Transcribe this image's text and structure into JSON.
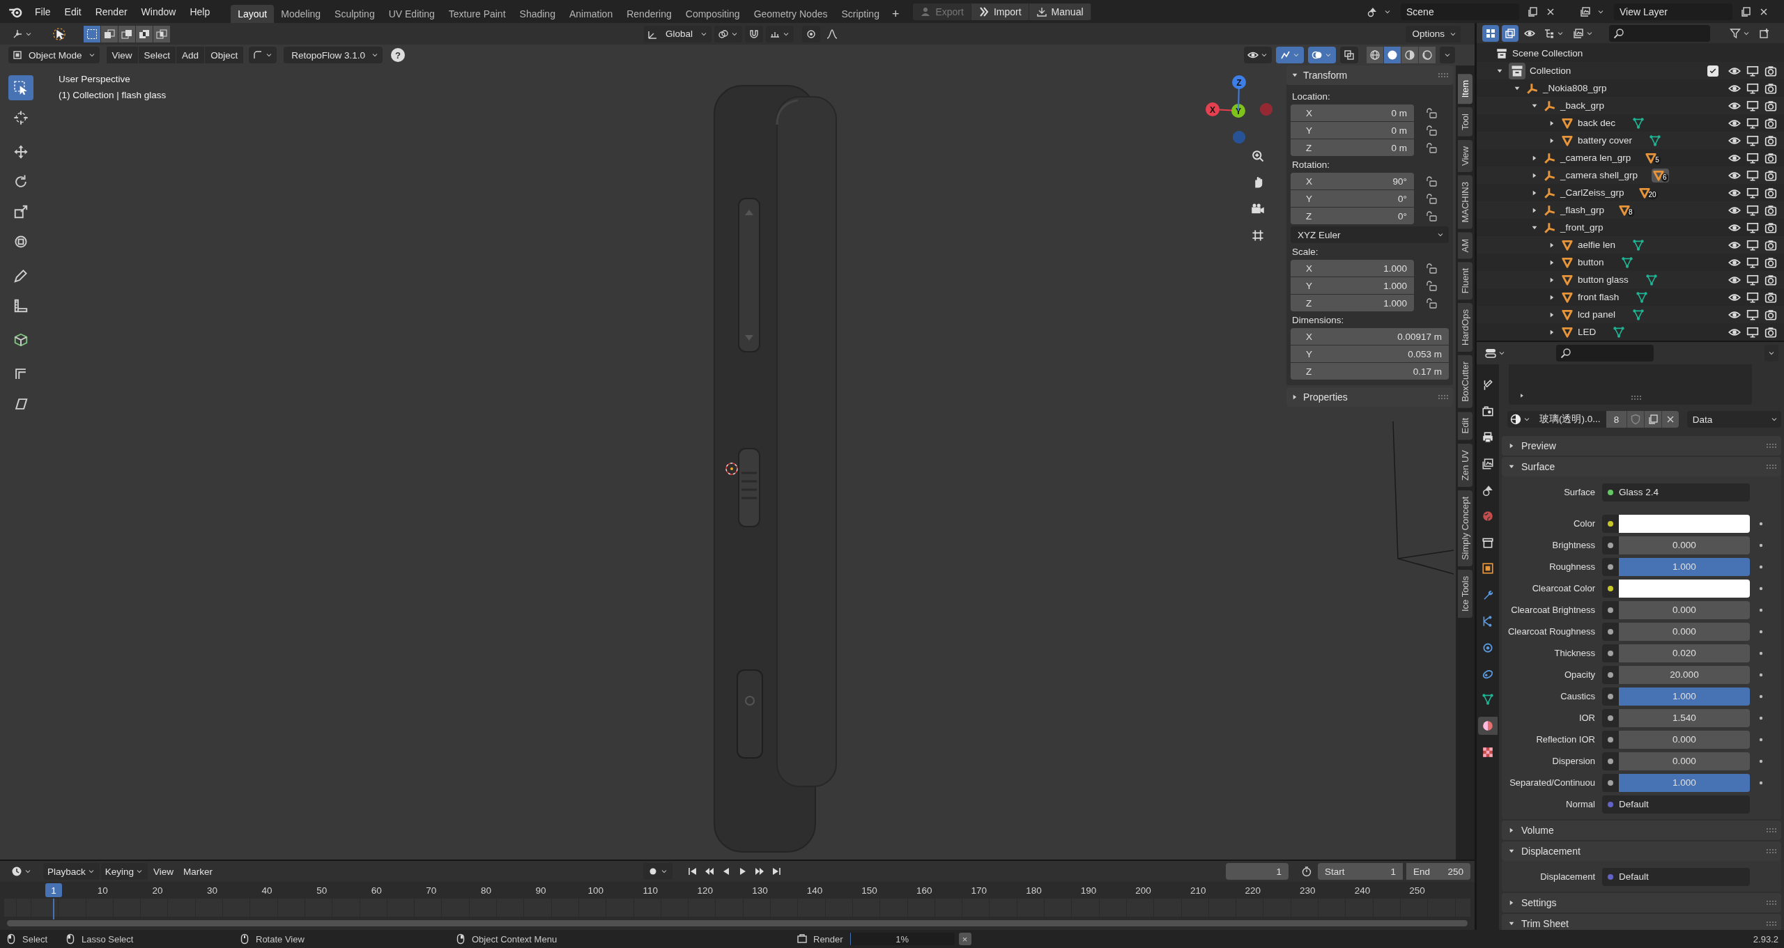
{
  "topbar": {
    "menus": [
      "File",
      "Edit",
      "Render",
      "Window",
      "Help"
    ],
    "workspaces": [
      {
        "label": "Layout",
        "selected": true
      },
      {
        "label": "Modeling",
        "selected": false
      },
      {
        "label": "Sculpting",
        "selected": false
      },
      {
        "label": "UV Editing",
        "selected": false
      },
      {
        "label": "Texture Paint",
        "selected": false
      },
      {
        "label": "Shading",
        "selected": false
      },
      {
        "label": "Animation",
        "selected": false
      },
      {
        "label": "Rendering",
        "selected": false
      },
      {
        "label": "Compositing",
        "selected": false
      },
      {
        "label": "Geometry Nodes",
        "selected": false
      },
      {
        "label": "Scripting",
        "selected": false
      }
    ],
    "add_workspace": "+",
    "addon_buttons": [
      {
        "label": "Export",
        "disabled": true
      },
      {
        "label": "Import",
        "disabled": false
      },
      {
        "label": "Manual",
        "disabled": false
      }
    ],
    "scene": "Scene",
    "view_layer": "View Layer"
  },
  "viewport": {
    "header": {
      "select_modes": [
        {
          "selected": true
        },
        {
          "selected": false
        },
        {
          "selected": false
        },
        {
          "selected": false
        },
        {
          "selected": false
        }
      ],
      "orientation": "Global",
      "options": "Options",
      "mode": "Object Mode",
      "menus": [
        "View",
        "Select",
        "Add",
        "Object"
      ],
      "addon_menu": "RetopoFlow 3.1.0",
      "help": "?",
      "toggles": [
        {
          "on": false
        },
        {
          "on": true
        },
        {
          "on": true
        },
        {
          "on": false
        }
      ],
      "shading": [
        {
          "selected": false
        },
        {
          "selected": true
        },
        {
          "selected": false
        },
        {
          "selected": false
        }
      ]
    },
    "tools": [
      {
        "selected": true
      },
      {
        "selected": false
      },
      {
        "selected": false
      },
      {
        "selected": false
      },
      {
        "selected": false
      },
      {
        "selected": false
      },
      {
        "selected": false
      },
      {
        "selected": false
      },
      {
        "selected": false
      },
      {
        "selected": false
      },
      {
        "selected": false
      }
    ],
    "overlay_text": [
      "User Perspective",
      "(1) Collection | flash glass"
    ],
    "gizmo": [
      {
        "label": "X",
        "color": "#e5404f"
      },
      {
        "label": "Y",
        "color": "#7fc21c"
      },
      {
        "label": "Z",
        "color": "#3d7fe6"
      }
    ]
  },
  "sidebar": {
    "tabs": [
      {
        "label": "Item",
        "selected": true
      },
      {
        "label": "Tool",
        "selected": false
      },
      {
        "label": "View",
        "selected": false
      },
      {
        "label": "MACHIN3",
        "selected": false
      },
      {
        "label": "AM",
        "selected": false
      },
      {
        "label": "Fluent",
        "selected": false
      },
      {
        "label": "HardOps",
        "selected": false
      },
      {
        "label": "BoxCutter",
        "selected": false
      },
      {
        "label": "Edit",
        "selected": false
      },
      {
        "label": "Zen UV",
        "selected": false
      },
      {
        "label": "Simply Concept",
        "selected": false
      },
      {
        "label": "Ice Tools",
        "selected": false
      }
    ],
    "panels": [
      {
        "title": "Transform",
        "expanded": true,
        "groups": [
          {
            "label": "Location:",
            "locks": true,
            "fields": [
              {
                "axis": "X",
                "value": "0 m"
              },
              {
                "axis": "Y",
                "value": "0 m"
              },
              {
                "axis": "Z",
                "value": "0 m"
              }
            ]
          },
          {
            "label": "Rotation:",
            "locks": true,
            "fields": [
              {
                "axis": "X",
                "value": "90°"
              },
              {
                "axis": "Y",
                "value": "0°"
              },
              {
                "axis": "Z",
                "value": "0°"
              }
            ],
            "mode": "XYZ Euler"
          },
          {
            "label": "Scale:",
            "locks": true,
            "fields": [
              {
                "axis": "X",
                "value": "1.000"
              },
              {
                "axis": "Y",
                "value": "1.000"
              },
              {
                "axis": "Z",
                "value": "1.000"
              }
            ]
          },
          {
            "label": "Dimensions:",
            "locks": false,
            "fields": [
              {
                "axis": "X",
                "value": "0.00917 m"
              },
              {
                "axis": "Y",
                "value": "0.053 m"
              },
              {
                "axis": "Z",
                "value": "0.17 m"
              }
            ]
          }
        ]
      },
      {
        "title": "Properties",
        "expanded": false
      }
    ]
  },
  "timeline": {
    "menus": [
      {
        "label": "Playback",
        "kind": "dropdown"
      },
      {
        "label": "Keying",
        "kind": "dropdown"
      },
      {
        "label": "View",
        "kind": "menu"
      },
      {
        "label": "Marker",
        "kind": "menu"
      }
    ],
    "current_frame": "1",
    "start_label": "Start",
    "start": "1",
    "end_label": "End",
    "end": "250",
    "playhead": "1",
    "ticks": [
      "10",
      "20",
      "30",
      "40",
      "50",
      "60",
      "70",
      "80",
      "90",
      "100",
      "110",
      "120",
      "130",
      "140",
      "150",
      "160",
      "170",
      "180",
      "190",
      "200",
      "210",
      "220",
      "230",
      "240",
      "250"
    ]
  },
  "outliner": {
    "sync_toggles": [
      {
        "on": true
      },
      {
        "on": true
      }
    ],
    "tree": [
      {
        "label": "Scene Collection",
        "kind": "scene",
        "children": [
          {
            "label": "Collection",
            "kind": "collection",
            "expanded": true,
            "active": true,
            "checked": true,
            "children": [
              {
                "label": "_Nokia808_grp",
                "kind": "empty",
                "expanded": true,
                "children": [
                  {
                    "label": "_back_grp",
                    "kind": "empty",
                    "expanded": true,
                    "children": [
                      {
                        "label": "back dec",
                        "kind": "mesh",
                        "expanded": false,
                        "mesh_data": true
                      },
                      {
                        "label": "battery cover",
                        "kind": "mesh",
                        "expanded": false,
                        "mesh_data": true
                      }
                    ]
                  },
                  {
                    "label": "_camera len_grp",
                    "kind": "empty",
                    "expanded": false,
                    "count": "5",
                    "count_highlighted": false
                  },
                  {
                    "label": "_camera shell_grp",
                    "kind": "empty",
                    "expanded": false,
                    "count": "6",
                    "count_highlighted": true
                  },
                  {
                    "label": "_CarlZeiss_grp",
                    "kind": "empty",
                    "expanded": false,
                    "count": "20",
                    "count_highlighted": false
                  },
                  {
                    "label": "_flash_grp",
                    "kind": "empty",
                    "expanded": false,
                    "count": "8",
                    "count_highlighted": false
                  },
                  {
                    "label": "_front_grp",
                    "kind": "empty",
                    "expanded": true,
                    "children": [
                      {
                        "label": "aelfie len",
                        "kind": "mesh",
                        "expanded": false,
                        "mesh_data": true
                      },
                      {
                        "label": "button",
                        "kind": "mesh",
                        "expanded": false,
                        "mesh_data": true
                      },
                      {
                        "label": "button glass",
                        "kind": "mesh",
                        "expanded": false,
                        "mesh_data": true
                      },
                      {
                        "label": "front flash",
                        "kind": "mesh",
                        "expanded": false,
                        "mesh_data": true
                      },
                      {
                        "label": "lcd panel",
                        "kind": "mesh",
                        "expanded": false,
                        "mesh_data": true
                      },
                      {
                        "label": "LED",
                        "kind": "mesh",
                        "expanded": false,
                        "mesh_data": true
                      }
                    ]
                  }
                ]
              }
            ]
          }
        ]
      }
    ]
  },
  "properties": {
    "tabs": [
      {
        "selected": false
      },
      {
        "selected": false
      },
      {
        "selected": false
      },
      {
        "selected": false
      },
      {
        "selected": false
      },
      {
        "selected": false
      },
      {
        "selected": false
      },
      {
        "selected": false
      },
      {
        "selected": false
      },
      {
        "selected": false
      },
      {
        "selected": false
      },
      {
        "selected": false
      },
      {
        "selected": false
      },
      {
        "selected": true
      },
      {
        "selected": false
      }
    ],
    "material": {
      "name": "玻璃(透明).0...",
      "users": "8",
      "link": "Data"
    },
    "panels": [
      {
        "title": "Preview",
        "expanded": false
      },
      {
        "title": "Surface",
        "expanded": true,
        "rows": [
          {
            "label": "Surface",
            "kind": "shader",
            "value": "Glass 2.4"
          },
          {
            "label": "Color",
            "kind": "color",
            "color": "#ffffff"
          },
          {
            "label": "Brightness",
            "kind": "number",
            "value": "0.000"
          },
          {
            "label": "Roughness",
            "kind": "slider",
            "value": "1.000",
            "level": 1
          },
          {
            "label": "Clearcoat Color",
            "kind": "color",
            "color": "#ffffff"
          },
          {
            "label": "Clearcoat Brightness",
            "kind": "number",
            "value": "0.000"
          },
          {
            "label": "Clearcoat Roughness",
            "kind": "number",
            "value": "0.000"
          },
          {
            "label": "Thickness",
            "kind": "number",
            "value": "0.020"
          },
          {
            "label": "Opacity",
            "kind": "number",
            "value": "20.000"
          },
          {
            "label": "Caustics",
            "kind": "slider",
            "value": "1.000",
            "level": 1
          },
          {
            "label": "IOR",
            "kind": "number",
            "value": "1.540"
          },
          {
            "label": "Reflection IOR",
            "kind": "number",
            "value": "0.000"
          },
          {
            "label": "Dispersion",
            "kind": "number",
            "value": "0.000"
          },
          {
            "label": "Separated/Continuou",
            "kind": "slider",
            "value": "1.000",
            "level": 1
          },
          {
            "label": "Normal",
            "kind": "link",
            "value": "Default"
          }
        ]
      },
      {
        "title": "Volume",
        "expanded": false
      },
      {
        "title": "Displacement",
        "expanded": true,
        "rows": [
          {
            "label": "Displacement",
            "kind": "link",
            "value": "Default"
          }
        ]
      },
      {
        "title": "Settings",
        "expanded": false
      },
      {
        "title": "Trim Sheet",
        "expanded": true
      }
    ]
  },
  "status_bar": {
    "hints": [
      "Select",
      "Lasso Select",
      "Rotate View",
      "Object Context Menu"
    ],
    "job": {
      "label": "Render",
      "progress": "1%",
      "level": 0.01,
      "cancel": "×"
    },
    "version": "2.93.2"
  }
}
